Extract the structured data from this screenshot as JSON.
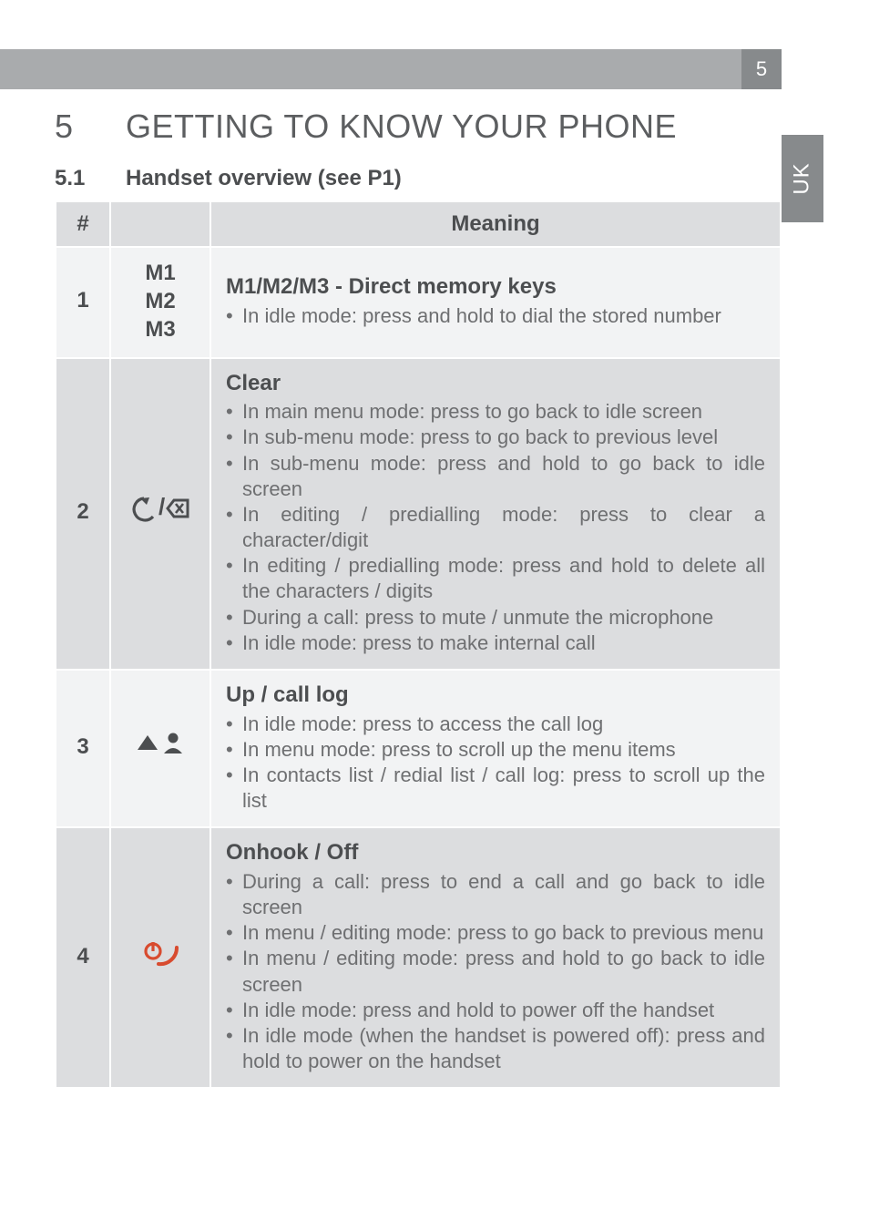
{
  "page_number": "5",
  "side_tab": "UK",
  "section": {
    "num": "5",
    "title": "GETTING TO KNOW YOUR PHONE"
  },
  "subsection": {
    "num": "5.1",
    "title": "Handset overview (see P1)"
  },
  "table": {
    "headers": {
      "num": "#",
      "icon": "",
      "meaning": "Meaning"
    },
    "rows": [
      {
        "num": "1",
        "icon_lines": [
          "M1",
          "M2",
          "M3"
        ],
        "title": "M1/M2/M3 - Direct memory keys",
        "bullets": [
          "In idle mode: press and hold to dial the stored number"
        ]
      },
      {
        "num": "2",
        "icon_svg": "back-delete",
        "title": "Clear",
        "bullets": [
          "In main menu mode: press to go back to idle screen",
          "In sub-menu mode: press to go back to previous level",
          "In sub-menu mode: press and hold to go back to idle screen",
          "In editing / predialling mode: press to clear a character/digit",
          "In editing / predialling mode: press and hold to delete all the characters / digits",
          "During a call: press to mute / unmute the microphone",
          "In idle mode: press to make internal call"
        ]
      },
      {
        "num": "3",
        "icon_svg": "up-person",
        "title": "Up / call log",
        "bullets": [
          "In idle mode: press to access the call log",
          "In menu mode: press to scroll up the menu items",
          "In contacts list / redial list / call log: press to scroll up the list"
        ]
      },
      {
        "num": "4",
        "icon_svg": "onhook",
        "title": "Onhook / Off",
        "bullets": [
          "During a call: press to end a call and go back to idle screen",
          "In menu / editing mode: press to go back to previous menu",
          "In menu / editing mode: press and hold to go back to idle screen",
          "In idle mode: press and hold to power off the handset",
          "In idle mode (when the handset is powered off): press and hold to power on the handset"
        ]
      }
    ]
  }
}
